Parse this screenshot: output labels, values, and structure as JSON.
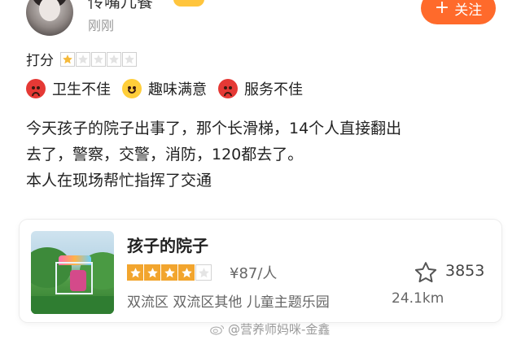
{
  "header": {
    "username": "传嘴儿餐",
    "time": "刚刚",
    "follow_label": "关注",
    "colors": {
      "follow_bg": "#ff6a2b",
      "badge": "#ffc53d"
    }
  },
  "rating": {
    "label": "打分",
    "stars_filled": 1,
    "stars_total": 5
  },
  "tags": [
    {
      "icon": "angry-face-icon",
      "text": "卫生不佳"
    },
    {
      "icon": "smile-face-icon",
      "text": "趣味满意"
    },
    {
      "icon": "angry-face-icon",
      "text": "服务不佳"
    }
  ],
  "review": {
    "line1": "今天孩子的院子出事了，那个长滑梯，14个人直接翻出",
    "line2": "去了，警察，交警，消防，120都去了。",
    "line3": "本人在现场帮忙指挥了交通"
  },
  "poi": {
    "name": "孩子的院子",
    "stars_filled": 4,
    "stars_total": 5,
    "price": "¥87/人",
    "fav_count": "3853",
    "meta": "双流区  双流区其他  儿童主题乐园",
    "distance": "24.1km",
    "colors": {
      "star_on": "#f2a52e"
    }
  },
  "watermark": {
    "text": "@营养师妈咪-金鑫"
  }
}
